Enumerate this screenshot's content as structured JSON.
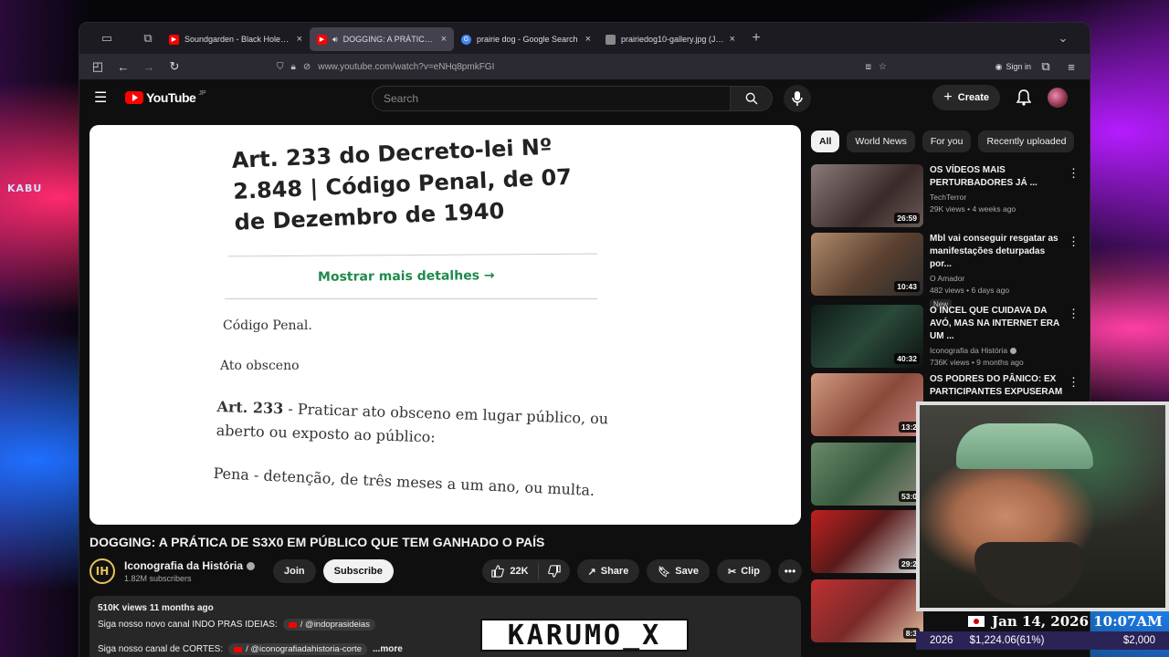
{
  "browser": {
    "tabs": [
      {
        "title": "Soundgarden - Black Hole Sun",
        "active": false,
        "favicon_color": "#ff0000"
      },
      {
        "title": "DOGGING: A PRÁTICA DE S",
        "active": true,
        "favicon_color": "#ff0000"
      },
      {
        "title": "prairie dog - Google Search",
        "active": false,
        "favicon_color": "#4285f4"
      },
      {
        "title": "prairiedog10-gallery.jpg (JPEG I",
        "active": false,
        "favicon_color": "#888888"
      }
    ],
    "url": "www.youtube.com/watch?v=eNHq8pmkFGI",
    "signin_label": "Sign in"
  },
  "youtube": {
    "logo_text": "YouTube",
    "region": "JP",
    "search_placeholder": "Search",
    "create_label": "Create"
  },
  "video_frame": {
    "heading": "Art. 233 do Decreto-lei Nº 2.848 | Código Penal, de 07 de Dezembro de 1940",
    "more_link": "Mostrar mais detalhes",
    "line1": "Código Penal.",
    "line2": "Ato obsceno",
    "article_label": "Art. 233",
    "article_text": " - Praticar ato obsceno em lugar público, ou aberto ou exposto ao público:",
    "penalty": "Pena - detenção, de três meses a um ano, ou multa."
  },
  "video": {
    "title": "DOGGING: A PRÁTICA DE S3X0 EM PÚBLICO QUE TEM GANHADO O PAÍS",
    "channel": "Iconografia da História",
    "channel_initials": "IH",
    "subscribers": "1.82M subscribers",
    "join_label": "Join",
    "subscribe_label": "Subscribe",
    "likes": "22K",
    "share_label": "Share",
    "save_label": "Save",
    "clip_label": "Clip",
    "views_date": "510K views  11 months ago",
    "desc_line1": "Siga nosso novo canal INDO PRAS IDEIAS:",
    "desc_link1": "/ @indoprasideias",
    "desc_line2": "Siga nosso canal de CORTES:",
    "desc_link2": "/ @iconografiadahistoria-corte",
    "more_label": "...more"
  },
  "sidebar": {
    "chips": [
      "All",
      "World News",
      "For you",
      "Recently uploaded"
    ],
    "recommendations": [
      {
        "title": "OS VÍDEOS MAIS PERTURBADORES JÁ ...",
        "channel": "TechTerror",
        "meta": "29K views • 4 weeks ago",
        "duration": "26:59",
        "thumb_color": "#5a4a4a"
      },
      {
        "title": "Mbl vai conseguir resgatar as manifestações deturpadas por...",
        "channel": "O Amador",
        "meta": "482 views • 6 days ago",
        "duration": "10:43",
        "thumb_color": "#6a5040",
        "badge": "New"
      },
      {
        "title": "O INCEL QUE CUIDAVA DA AVÓ, MAS NA INTERNET ERA UM ...",
        "channel": "Iconografia da História",
        "meta": "736K views • 9 months ago",
        "duration": "40:32",
        "thumb_color": "#1e2e28"
      },
      {
        "title": "OS PODRES DO PÂNICO: EX PARTICIPANTES EXPUSERAM ...",
        "channel": "",
        "meta": "",
        "duration": "13:2",
        "thumb_color": "#b07060"
      },
      {
        "title": "",
        "channel": "",
        "meta": "",
        "duration": "53:0",
        "thumb_color": "#4a6a50"
      },
      {
        "title": "",
        "channel": "",
        "meta": "",
        "duration": "29:2",
        "thumb_color": "#7a2a2a"
      },
      {
        "title": "",
        "channel": "",
        "meta": "",
        "duration": "8:3",
        "thumb_color": "#8a3a3a"
      }
    ]
  },
  "overlay": {
    "date": "Jan 14, 2026 10:07AM",
    "ticker_year": "2026",
    "ticker_value": "$1,224.06(61%)",
    "ticker_goal": "$2,000",
    "watermark": "KARUMO_X"
  }
}
